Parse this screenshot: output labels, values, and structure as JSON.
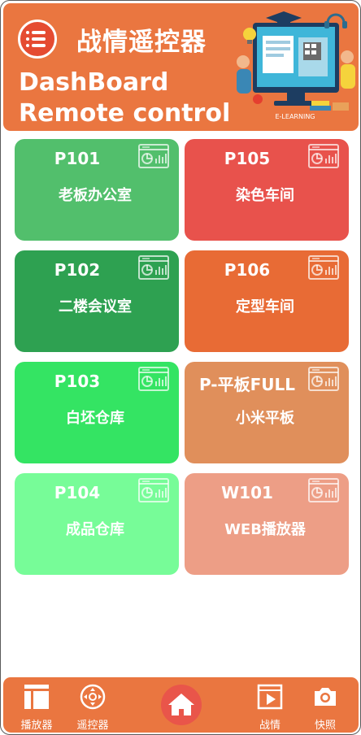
{
  "header": {
    "title": "战情遥控器",
    "subtitle_line1": "DashBoard",
    "subtitle_line2": "Remote control",
    "illustration_caption": "E-LEARNING"
  },
  "cards": [
    {
      "code": "P101",
      "name": "老板办公室",
      "color": "#52bf6c"
    },
    {
      "code": "P105",
      "name": "染色车间",
      "color": "#e8524c"
    },
    {
      "code": "P102",
      "name": "二楼会议室",
      "color": "#2ea151"
    },
    {
      "code": "P106",
      "name": "定型车间",
      "color": "#e86b35"
    },
    {
      "code": "P103",
      "name": "白坯仓库",
      "color": "#34e463"
    },
    {
      "code": "P-平板FULL",
      "name": "小米平板",
      "color": "#e08f5b"
    },
    {
      "code": "P104",
      "name": "成品仓库",
      "color": "#77fc98"
    },
    {
      "code": "W101",
      "name": "WEB播放器",
      "color": "#ed9e86"
    }
  ],
  "nav": {
    "player": "播放器",
    "remote": "遥控器",
    "dashboard": "战情",
    "snapshot": "快照"
  },
  "colors": {
    "primary": "#ea7640",
    "menu_button": "#e54b31",
    "home_button": "#e9554a"
  },
  "icons": {
    "menu": "menu-icon",
    "card": "dashboard-screen-icon",
    "player": "layout-panel-icon",
    "remote": "dpad-remote-icon",
    "home": "home-icon",
    "dashboard": "play-screen-icon",
    "snapshot": "camera-icon"
  }
}
